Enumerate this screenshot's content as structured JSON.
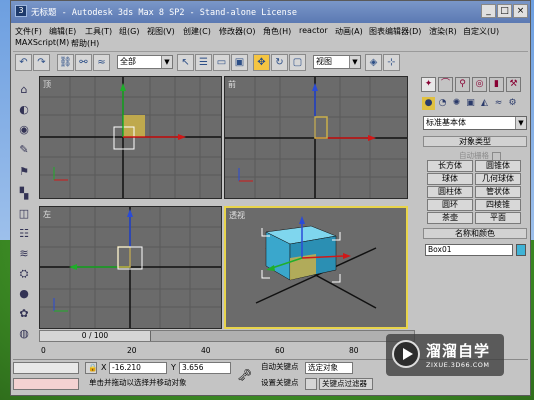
{
  "window": {
    "title": "无标题 - Autodesk 3ds Max 8 SP2 - Stand-alone License",
    "min_label": "_",
    "max_label": "□",
    "close_label": "×"
  },
  "menu": {
    "row1": [
      "文件(F)",
      "编辑(E)",
      "工具(T)",
      "组(G)",
      "视图(V)",
      "创建(C)",
      "修改器(O)",
      "角色(H)",
      "reactor",
      "动画(A)",
      "图表编辑器(D)",
      "渲染(R)",
      "自定义(U)"
    ],
    "row2": [
      "MAXScript(M)",
      "帮助(H)"
    ]
  },
  "toolbar": {
    "selection_filter": "全部",
    "reference_coord": "视图"
  },
  "viewports": {
    "top": "顶",
    "front": "前",
    "left": "左",
    "perspective": "透视"
  },
  "command_panel": {
    "category": "标准基本体",
    "object_type_header": "对象类型",
    "autogrid_label": "自动栅格",
    "buttons": [
      "长方体",
      "圆锥体",
      "球体",
      "几何球体",
      "圆柱体",
      "管状体",
      "圆环",
      "四棱锥",
      "茶壶",
      "平面"
    ],
    "name_color_header": "名称和颜色",
    "object_name": "Box01",
    "object_color": "#3fb3d6"
  },
  "timeline": {
    "frame_display": "0 / 100",
    "ruler_ticks": [
      "0",
      "20",
      "40",
      "60",
      "80",
      "100"
    ]
  },
  "status": {
    "x_value": "-16.210",
    "y_value": "3.656",
    "auto_key": "自动关键点",
    "set_key": "设置关键点",
    "selected_object": "选定对象",
    "key_filters": "关键点过滤器",
    "prompt": "单击并拖动以选择并移动对象",
    "x_label": "X",
    "y_label": "Y"
  },
  "watermark": {
    "title": "溜溜自学",
    "url": "ZIXUE.3D66.COM"
  }
}
